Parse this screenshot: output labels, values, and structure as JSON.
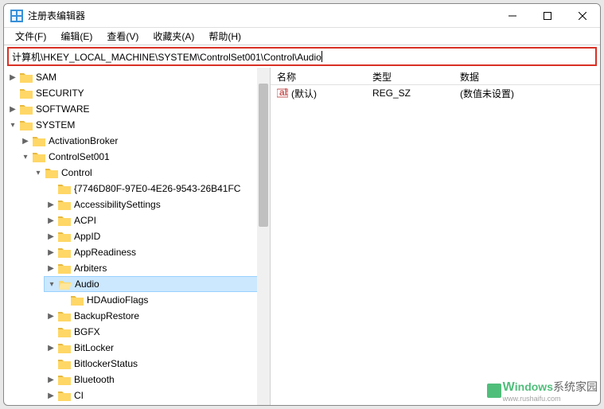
{
  "window": {
    "title": "注册表编辑器"
  },
  "menu": {
    "file": "文件(F)",
    "edit": "编辑(E)",
    "view": "查看(V)",
    "favorites": "收藏夹(A)",
    "help": "帮助(H)"
  },
  "address": "计算机\\HKEY_LOCAL_MACHINE\\SYSTEM\\ControlSet001\\Control\\Audio",
  "tree": {
    "sam": "SAM",
    "security": "SECURITY",
    "software": "SOFTWARE",
    "system": "SYSTEM",
    "activationbroker": "ActivationBroker",
    "controlset001": "ControlSet001",
    "control": "Control",
    "guid": "{7746D80F-97E0-4E26-9543-26B41FC",
    "accessibility": "AccessibilitySettings",
    "acpi": "ACPI",
    "appid": "AppID",
    "appreadiness": "AppReadiness",
    "arbiters": "Arbiters",
    "audio": "Audio",
    "hdaudioflags": "HDAudioFlags",
    "backuprestore": "BackupRestore",
    "bgfx": "BGFX",
    "bitlocker": "BitLocker",
    "bitlockerstatus": "BitlockerStatus",
    "bluetooth": "Bluetooth",
    "ci": "CI"
  },
  "list": {
    "headers": {
      "name": "名称",
      "type": "类型",
      "data": "数据"
    },
    "row0": {
      "name": "(默认)",
      "type": "REG_SZ",
      "data": "(数值未设置)"
    }
  },
  "watermark": {
    "brand1": "indows",
    "brand2": "系统家园",
    "sub": "www.rushaifu.com"
  },
  "colors": {
    "highlight_border": "#d93025",
    "selection": "#cce8ff",
    "accent": "#3eb76d"
  }
}
